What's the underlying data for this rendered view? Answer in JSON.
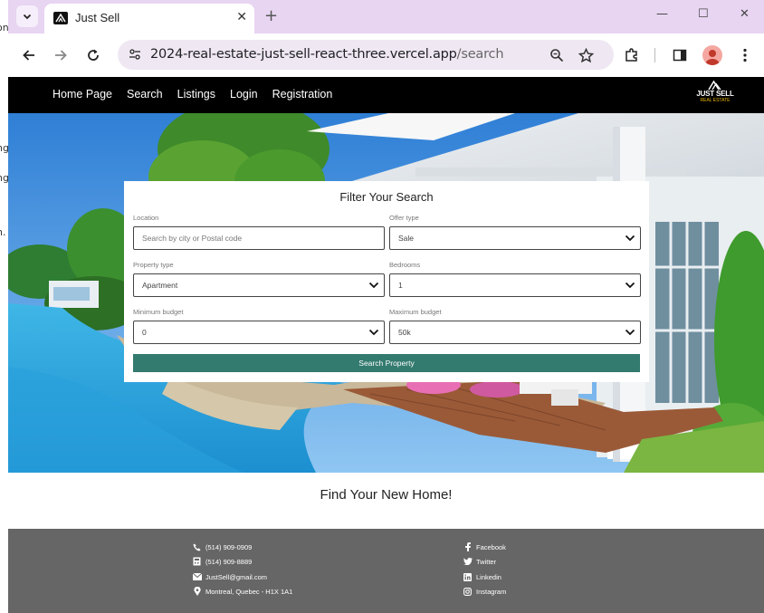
{
  "background_window": {
    "fragments": [
      "on",
      "ng",
      "ng",
      "n."
    ]
  },
  "browser": {
    "tab_title": "Just Sell",
    "url_host": "2024-real-estate-just-sell-react-three.vercel.app",
    "url_path": "/search",
    "icons": [
      "tab-search-icon",
      "close-icon",
      "new-tab-icon",
      "minimize-icon",
      "maximize-icon",
      "window-close-icon",
      "back-icon",
      "forward-icon",
      "reload-icon",
      "site-info-icon",
      "zoom-icon",
      "bookmark-star-icon",
      "extensions-icon",
      "side-panel-icon",
      "profile-avatar",
      "menu-icon"
    ]
  },
  "site_nav": {
    "links": [
      "Home Page",
      "Search",
      "Listings",
      "Login",
      "Registration"
    ],
    "logo_line1": "JUST SELL",
    "logo_line2": "REAL ESTATE"
  },
  "filter": {
    "title": "Filter Your Search",
    "location_label": "Location",
    "location_placeholder": "Search by city or Postal code",
    "offer_label": "Offer type",
    "offer_value": "Sale",
    "property_label": "Property type",
    "property_value": "Apartment",
    "bedrooms_label": "Bedrooms",
    "bedrooms_value": "1",
    "min_label": "Minimum budget",
    "min_value": "0",
    "max_label": "Maximum budget",
    "max_value": "50k",
    "button": "Search Property"
  },
  "heading": "Find Your New Home!",
  "footer": {
    "contact": [
      {
        "icon": "phone-icon",
        "text": "(514) 909-0909"
      },
      {
        "icon": "fax-icon",
        "text": "(514) 909-8889"
      },
      {
        "icon": "mail-icon",
        "text": "JustSell@gmail.com"
      },
      {
        "icon": "location-pin-icon",
        "text": "Montreal, Quebec - H1X 1A1"
      }
    ],
    "social": [
      {
        "icon": "facebook-icon",
        "text": "Facebook"
      },
      {
        "icon": "twitter-icon",
        "text": "Twitter"
      },
      {
        "icon": "linkedin-icon",
        "text": "Linkedin"
      },
      {
        "icon": "instagram-icon",
        "text": "Instagram"
      }
    ]
  },
  "colors": {
    "tab_strip": "#e8d5f2",
    "nav_bar": "#000000",
    "button": "#337a6f",
    "footer": "#666666",
    "logo_accent": "#e8b400"
  }
}
